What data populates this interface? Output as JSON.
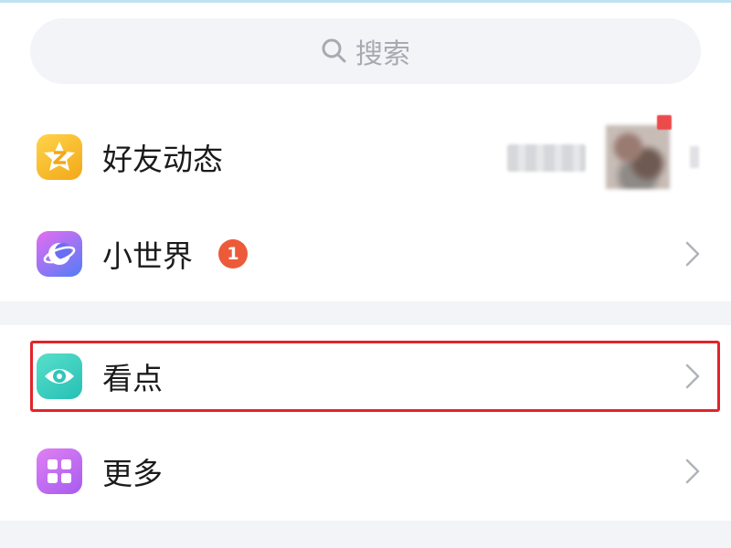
{
  "search": {
    "placeholder": "搜索",
    "icon": "search-icon"
  },
  "menu": [
    {
      "id": "friends-feed",
      "label": "好友动态",
      "icon": "qzone-star-icon",
      "icon_color": "#f5b820"
    },
    {
      "id": "small-world",
      "label": "小世界",
      "icon": "moon-planet-icon",
      "icon_color": "#6a6ef5",
      "badge": "1"
    },
    {
      "id": "kandian",
      "label": "看点",
      "icon": "eye-icon",
      "icon_color": "#3fd0c0",
      "highlighted": true
    },
    {
      "id": "more",
      "label": "更多",
      "icon": "grid-icon",
      "icon_color": "#c06cf0"
    }
  ],
  "colors": {
    "badge": "#ec5a3a",
    "highlight_border": "#e2242a",
    "section_gap": "#f3f4f7"
  }
}
